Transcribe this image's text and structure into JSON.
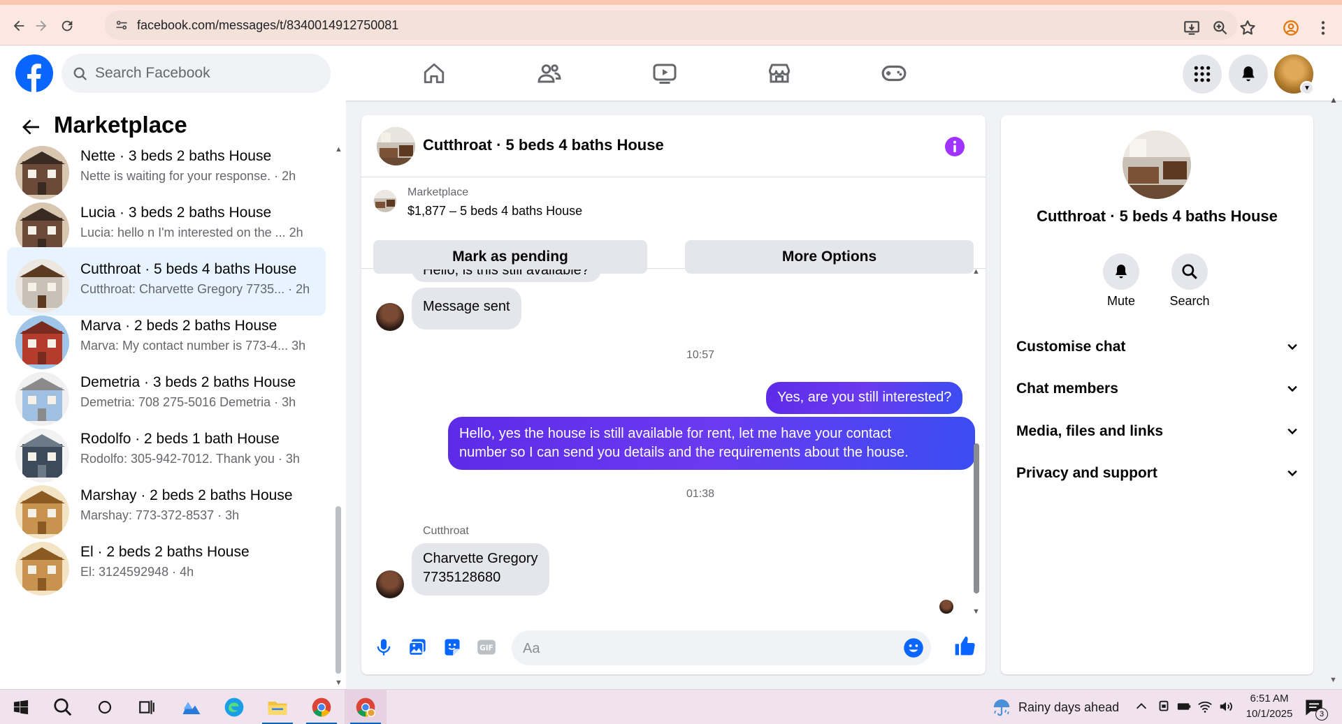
{
  "browser": {
    "url": "facebook.com/messages/t/8340014912750081"
  },
  "header": {
    "search_placeholder": "Search Facebook"
  },
  "marketplace": {
    "title": "Marketplace",
    "conversations": [
      {
        "title": "Nette · 3 beds 2 baths House",
        "subtitle": "Nette is waiting for your response. · 2h",
        "active": false
      },
      {
        "title": "Lucia · 3 beds 2 baths House",
        "subtitle": "Lucia: hello n I'm interested on the ...   2h",
        "active": false
      },
      {
        "title": "Cutthroat · 5 beds 4 baths House",
        "subtitle": "Cutthroat: Charvette Gregory 7735...  · 2h",
        "active": true
      },
      {
        "title": "Marva · 2 beds 2 baths House",
        "subtitle": "Marva: My contact number is 773-4...  3h",
        "active": false
      },
      {
        "title": "Demetria · 3 beds 2 baths House",
        "subtitle": "Demetria: 708 275-5016 Demetria · 3h",
        "active": false
      },
      {
        "title": "Rodolfo · 2 beds 1 bath House",
        "subtitle": "Rodolfo: 305-942-7012. Thank you · 3h",
        "active": false
      },
      {
        "title": "Marshay · 2 beds 2 baths House",
        "subtitle": "Marshay: 773-372-8537 · 3h",
        "active": false
      },
      {
        "title": "El · 2 beds 2 baths House",
        "subtitle": "El: 3124592948 · 4h",
        "active": false
      }
    ]
  },
  "chat": {
    "title": "Cutthroat · 5 beds 4 baths House",
    "listing_category": "Marketplace",
    "listing_price": "$1,877 – 5 beds 4 baths House",
    "mark_pending": "Mark as pending",
    "more_options": "More Options",
    "partial_message": "Hello, is this still available?",
    "message_sent": "Message sent",
    "time1": "10:57",
    "out1": "Yes, are you still interested?",
    "out2_line1": "Hello, yes the house is still available for rent, let me have your contact",
    "out2_line2": "number so I can send you details and the requirements about the house.",
    "time2": "01:38",
    "sender_name": "Cutthroat",
    "in_line1": "Charvette Gregory",
    "in_line2": "7735128680",
    "composer_placeholder": "Aa"
  },
  "info": {
    "title": "Cutthroat · 5 beds 4 baths House",
    "mute": "Mute",
    "search": "Search",
    "sections": [
      "Customise chat",
      "Chat members",
      "Media, files and links",
      "Privacy and support"
    ]
  },
  "taskbar": {
    "weather": "Rainy days ahead",
    "time": "6:51 AM",
    "date": "10/1/2025",
    "notif_count": "3"
  },
  "colors": {
    "fb_blue": "#0866ff",
    "active_row": "#e7f3ff",
    "info_purple": "#a033ff"
  }
}
